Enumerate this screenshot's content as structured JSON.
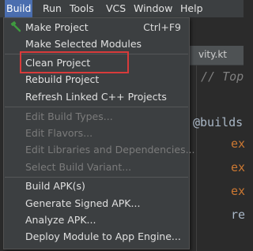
{
  "menubar": {
    "items": [
      "Build",
      "Run",
      "Tools",
      "VCS",
      "Window",
      "Help"
    ],
    "active": "Build"
  },
  "editor": {
    "tab_label": "vity.kt",
    "lines": [
      "// Top",
      "@builds",
      "ex",
      "ex",
      "ex",
      "re"
    ]
  },
  "build_menu": {
    "items": [
      {
        "label": "Make Project",
        "shortcut": "Ctrl+F9",
        "icon": "hammer-icon",
        "enabled": true
      },
      {
        "label": "Make Selected Modules",
        "enabled": true
      },
      {
        "label": "Clean Project",
        "enabled": true,
        "highlighted": true
      },
      {
        "label": "Rebuild Project",
        "enabled": true
      },
      {
        "label": "Refresh Linked C++ Projects",
        "enabled": true
      },
      {
        "label": "Edit Build Types...",
        "enabled": false
      },
      {
        "label": "Edit Flavors...",
        "enabled": false
      },
      {
        "label": "Edit Libraries and Dependencies...",
        "enabled": false
      },
      {
        "label": "Select Build Variant...",
        "enabled": false
      },
      {
        "label": "Build APK(s)",
        "enabled": true
      },
      {
        "label": "Generate Signed APK...",
        "enabled": true
      },
      {
        "label": "Analyze APK...",
        "enabled": true
      },
      {
        "label": "Deploy Module to App Engine...",
        "enabled": true
      }
    ]
  },
  "colors": {
    "menu_bg": "#3c3f41",
    "active_menu": "#4b6eaf",
    "highlight_border": "#d83b3b",
    "hammer": "#3f9b3f"
  }
}
